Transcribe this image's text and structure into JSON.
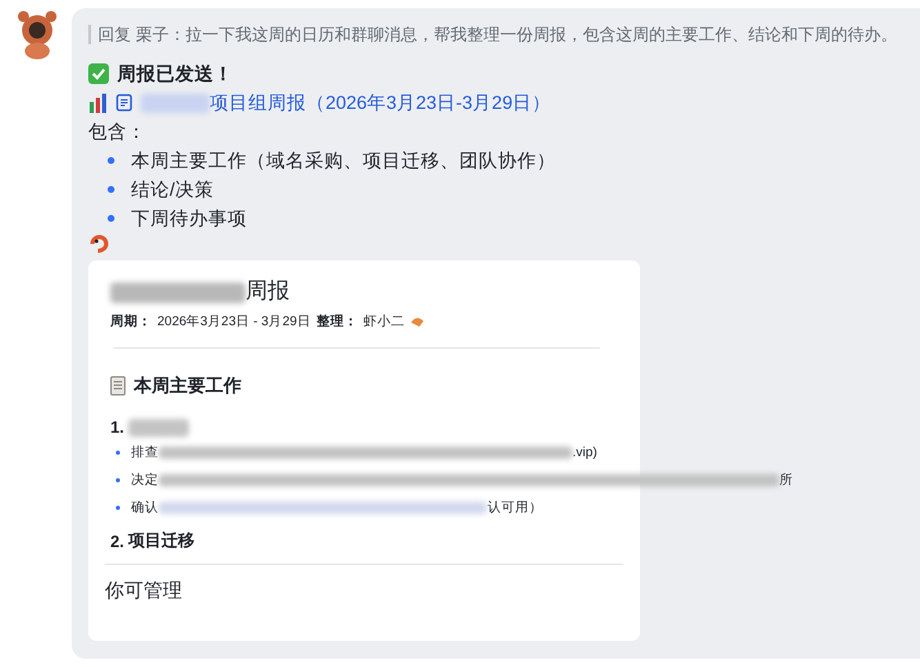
{
  "reply_quote": "回复 栗子：拉一下我这周的日历和群聊消息，帮我整理一份周报，包含这周的主要工作、结论和下周的待办。",
  "status_text": "周报已发送！",
  "doc_link": "项目组周报（2026年3月23日-3月29日）",
  "contains_label": "包含：",
  "contains_items": [
    "本周主要工作（域名采购、项目迁移、团队协作）",
    "结论/决策",
    "下周待办事项"
  ],
  "card": {
    "title": "周报",
    "meta": [
      {
        "label": "周期：",
        "value": "2026年3月23日 - 3月29日"
      },
      {
        "label": "整理：",
        "value": "虾小二"
      }
    ],
    "section_title": "本周主要工作",
    "items": [
      {
        "number": "1.",
        "bullets": [
          {
            "start": "排查",
            "end": ".vip)"
          },
          {
            "start": "决定",
            "end": "所"
          },
          {
            "start": "确认",
            "end": "认可用）"
          }
        ]
      },
      {
        "number": "2.",
        "title": "项目迁移"
      }
    ],
    "footer": "你可管理"
  }
}
